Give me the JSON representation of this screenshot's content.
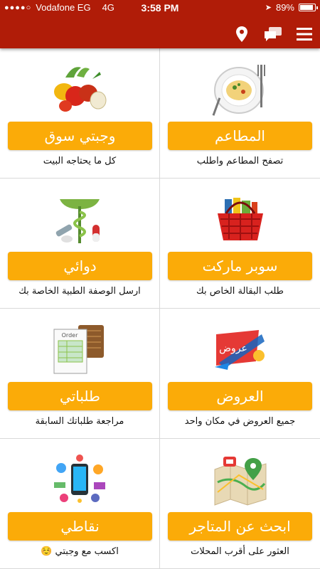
{
  "status_bar": {
    "carrier": "Vodafone EG",
    "network": "4G",
    "time": "3:58 PM",
    "battery": "89%",
    "battery_level": 0.89
  },
  "header": {
    "icons": [
      "location-pin-icon",
      "chat-icon",
      "menu-icon"
    ],
    "color": "#b01c08"
  },
  "tiles": [
    {
      "title": "المطاعم",
      "subtitle": "تصفح المطاعم واطلب",
      "icon": "plate-icon"
    },
    {
      "title": "وجبتي سوق",
      "subtitle": "كل ما يحتاجه البيت",
      "icon": "vegetables-icon"
    },
    {
      "title": "سوبر ماركت",
      "subtitle": "طلب البقالة الخاص بك",
      "icon": "basket-icon"
    },
    {
      "title": "دوائي",
      "subtitle": "ارسل الوصفة الطبية الخاصة بك",
      "icon": "pharmacy-icon"
    },
    {
      "title": "العروض",
      "subtitle": "جميع العروض في مكان واحد",
      "icon": "offers-icon"
    },
    {
      "title": "طلباتي",
      "subtitle": "مراجعة طلباتك السابقة",
      "icon": "orders-icon"
    },
    {
      "title": "ابحث عن المتاجر",
      "subtitle": "العثور على أقرب المحلات",
      "icon": "map-icon"
    },
    {
      "title": "نقاطي",
      "subtitle": "اكسب مع وجبتي ☺️",
      "icon": "points-icon"
    }
  ],
  "offers_badge": "عروض",
  "orders_label": "Order",
  "colors": {
    "button": "#fbab08",
    "header": "#b01c08",
    "divider": "#d9d9d9"
  }
}
